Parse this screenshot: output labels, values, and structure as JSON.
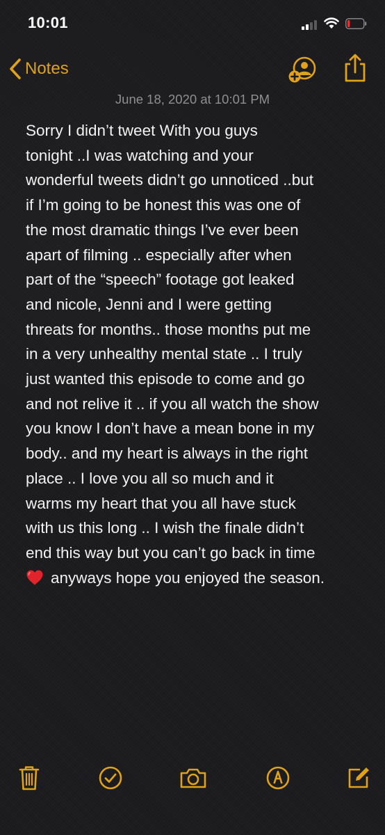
{
  "status_bar": {
    "time": "10:01",
    "icons": [
      "signal-icon",
      "wifi-icon",
      "battery-low-icon"
    ],
    "battery_color": "#e5322e"
  },
  "nav": {
    "back_label": "Notes",
    "back_icon": "chevron-left-icon",
    "actions": [
      "add-person-icon",
      "share-icon"
    ],
    "accent_color": "#e0a21b"
  },
  "note": {
    "date": "June 18, 2020 at 10:01 PM",
    "lines": [
      "Sorry I didn’t tweet With you guys",
      "tonight ..I was watching and your",
      "wonderful tweets didn’t go unnoticed ..but",
      "if I’m going to be honest this was one of",
      "the most dramatic things I’ve ever been",
      "apart of filming .. especially after when",
      "part of the “speech” footage got leaked",
      "and nicole, Jenni and I were getting",
      "threats for months.. those months put me",
      "in a very unhealthy mental state .. I truly",
      "just wanted this episode to come and go",
      "and not relive it .. if you all watch the show",
      "you know I don’t have a mean bone in my",
      "body.. and my heart is always in the right",
      "place .. I love you all so much and it",
      "warms my heart that you all have stuck",
      "with us this long .. I wish the finale didn’t",
      "end this way but you can’t go back in time"
    ],
    "last_line": "anyways hope you enjoyed the season.",
    "last_line_icon": "red-heart-icon"
  },
  "toolbar": {
    "icons": [
      "trash-icon",
      "checklist-icon",
      "camera-icon",
      "markup-icon",
      "compose-icon"
    ]
  }
}
